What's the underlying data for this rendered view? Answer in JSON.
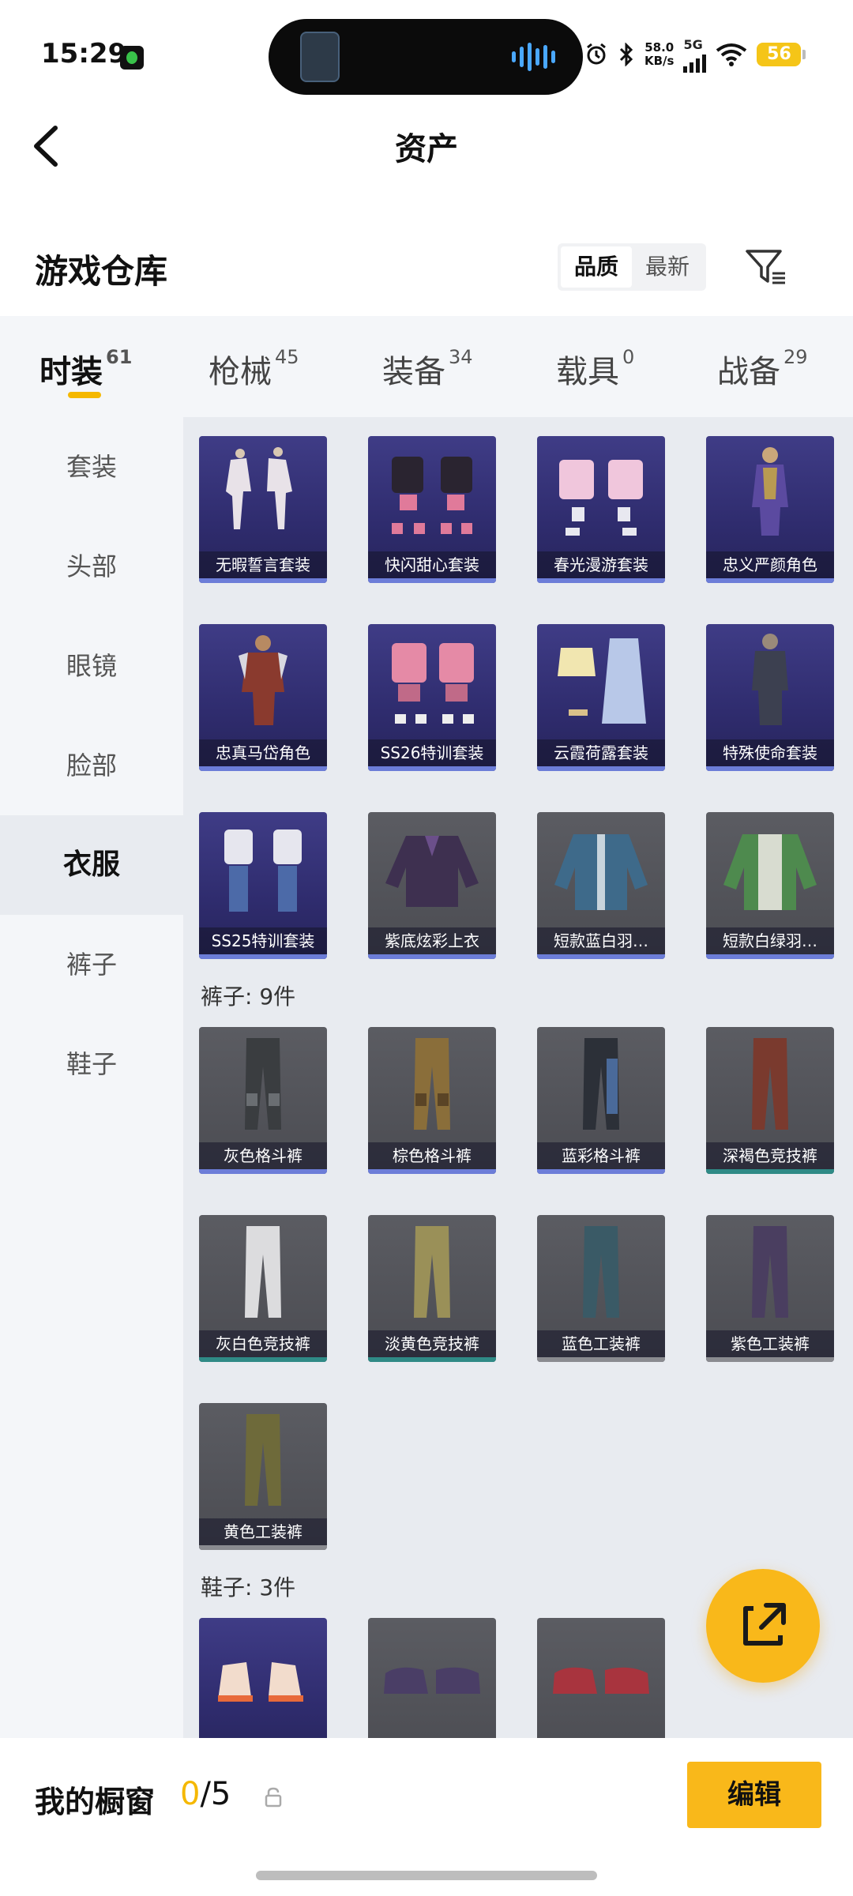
{
  "status_bar": {
    "time": "15:29",
    "net_speed_value": "58.0",
    "net_speed_unit": "KB/s",
    "network": "5G",
    "battery": "56"
  },
  "header": {
    "title": "资产"
  },
  "warehouse": {
    "title": "游戏仓库",
    "sort_options": [
      "品质",
      "最新"
    ],
    "active_sort": "品质"
  },
  "tabs": [
    {
      "label": "时装",
      "count": "61"
    },
    {
      "label": "枪械",
      "count": "45"
    },
    {
      "label": "装备",
      "count": "34"
    },
    {
      "label": "载具",
      "count": "0"
    },
    {
      "label": "战备",
      "count": "29"
    }
  ],
  "categories": [
    "套装",
    "头部",
    "眼镜",
    "脸部",
    "衣服",
    "裤子",
    "鞋子"
  ],
  "active_category": "衣服",
  "items": {
    "clothes": [
      {
        "label": "无暇誓言套装",
        "style": "purple"
      },
      {
        "label": "快闪甜心套装",
        "style": "purple"
      },
      {
        "label": "春光漫游套装",
        "style": "purple"
      },
      {
        "label": "忠义严颜角色",
        "style": "purple"
      },
      {
        "label": "忠真马岱角色",
        "style": "purple"
      },
      {
        "label": "SS26特训套装",
        "style": "purple"
      },
      {
        "label": "云霞荷露套装",
        "style": "purple"
      },
      {
        "label": "特殊使命套装",
        "style": "purple"
      },
      {
        "label": "SS25特训套装",
        "style": "purple"
      },
      {
        "label": "紫底炫彩上衣",
        "style": "gray"
      },
      {
        "label": "短款蓝白羽…",
        "style": "gray"
      },
      {
        "label": "短款白绿羽…",
        "style": "gray"
      }
    ],
    "pants_title": "裤子: 9件",
    "pants": [
      {
        "label": "灰色格斗裤"
      },
      {
        "label": "棕色格斗裤"
      },
      {
        "label": "蓝彩格斗裤"
      },
      {
        "label": "深褐色竞技裤"
      },
      {
        "label": "灰白色竞技裤"
      },
      {
        "label": "淡黄色竞技裤"
      },
      {
        "label": "蓝色工装裤"
      },
      {
        "label": "紫色工装裤"
      },
      {
        "label": "黄色工装裤"
      }
    ],
    "shoes_title": "鞋子: 3件"
  },
  "bottom": {
    "showcase_label": "我的橱窗",
    "showcase_current": "0",
    "showcase_total": "/5",
    "edit_label": "编辑"
  },
  "colors": {
    "accent": "#f9b81a",
    "purple_card": "#3a3780",
    "gray_card": "#56575d"
  }
}
